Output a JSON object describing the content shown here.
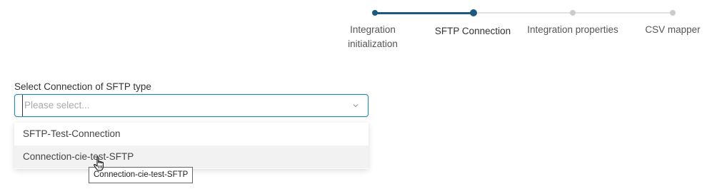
{
  "stepper": {
    "steps": [
      {
        "label_line1": "Integration",
        "label_line2": "initialization",
        "state": "done"
      },
      {
        "label_line1": "SFTP Connection",
        "label_line2": "",
        "state": "current"
      },
      {
        "label_line1": "Integration properties",
        "label_line2": "",
        "state": "upcoming"
      },
      {
        "label_line1": "CSV mapper",
        "label_line2": "",
        "state": "upcoming"
      }
    ]
  },
  "field": {
    "label": "Select Connection of SFTP type",
    "placeholder": "Please select...",
    "icon": "chevron-down-icon"
  },
  "dropdown": {
    "options": [
      {
        "label": "SFTP-Test-Connection"
      },
      {
        "label": "Connection-cie-test-SFTP"
      }
    ],
    "hovered_index": 1
  },
  "tooltip": {
    "text": "Connection-cie-test-SFTP"
  },
  "colors": {
    "accent": "#1b5a7e",
    "focus_border": "#2a8ab0",
    "inactive": "#cccccc"
  }
}
